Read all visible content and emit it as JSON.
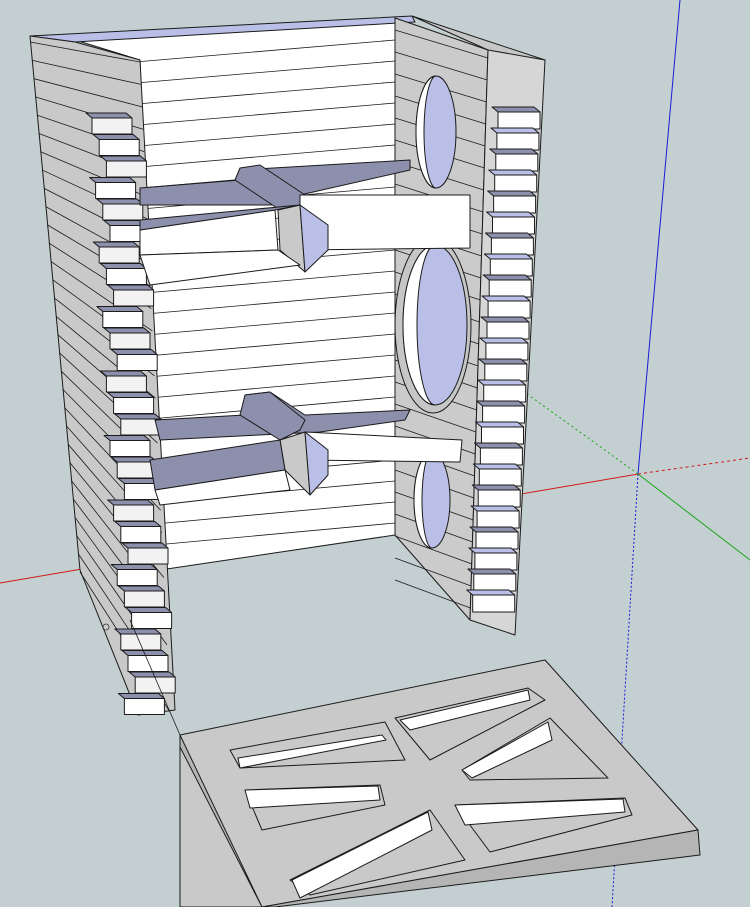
{
  "scene": {
    "type": "3d-model-viewport",
    "colors": {
      "background": "#c3cfd0",
      "face_front": "#ffffff",
      "face_back": "#b9bfe6",
      "face_side": "#c9c9c9",
      "face_shadow": "#8c90ad",
      "axis_red": "#d11a1a",
      "axis_green": "#1aa61a",
      "axis_blue": "#1a1ad6",
      "edge": "#1b1b1b"
    },
    "axes": [
      "red-axis",
      "green-axis",
      "blue-axis"
    ],
    "objects": [
      {
        "name": "speaker-enclosure",
        "parts": [
          "back-wall",
          "left-wall",
          "front-baffle",
          "upper-brace",
          "lower-brace",
          "tweeter-cutout",
          "woofer-cutout",
          "port-cutout"
        ]
      },
      {
        "name": "bottom-panel",
        "parts": [
          "frame",
          "opening-top-left",
          "opening-top-right",
          "opening-bottom-left",
          "opening-bottom-right"
        ]
      }
    ]
  }
}
